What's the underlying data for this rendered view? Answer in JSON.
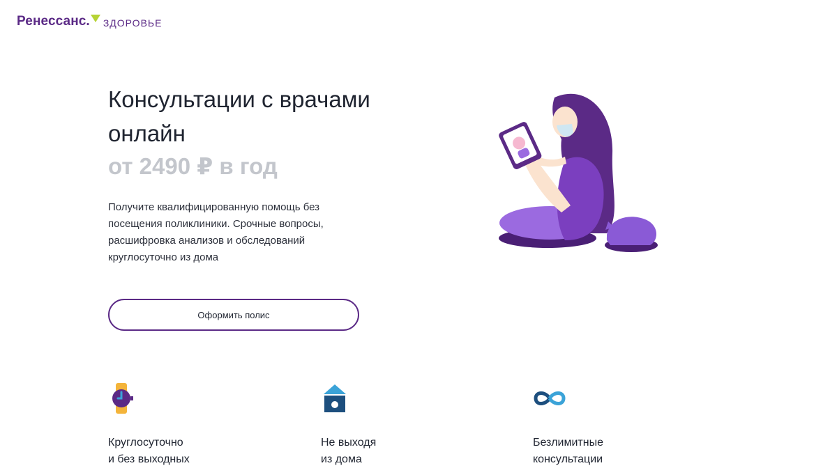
{
  "header": {
    "logo_main": "Ренессанс.",
    "logo_sub": "ЗДОРОВЬЕ"
  },
  "hero": {
    "headline": "Консультации с врачами онлайн",
    "price": "от 2490 ₽ в год",
    "description": "Получите квалифицированную помощь без посещения поликлиники. Срочные вопросы, расшифровка анализов и обследований круглосуточно из дома",
    "cta_label": "Оформить полис"
  },
  "features": [
    {
      "icon": "watch-icon",
      "label": "Круглосуточно\nи без выходных"
    },
    {
      "icon": "house-icon",
      "label": "Не выходя\nиз дома"
    },
    {
      "icon": "infinity-icon",
      "label": "Безлимитные\nконсультации"
    }
  ],
  "colors": {
    "brand": "#5b2a86",
    "accent": "#b6d334",
    "illustration_purple": "#7b3fbf",
    "icon_navy": "#1d4f7e",
    "icon_sky": "#3ba3d8",
    "icon_yellow": "#f4b43a"
  }
}
